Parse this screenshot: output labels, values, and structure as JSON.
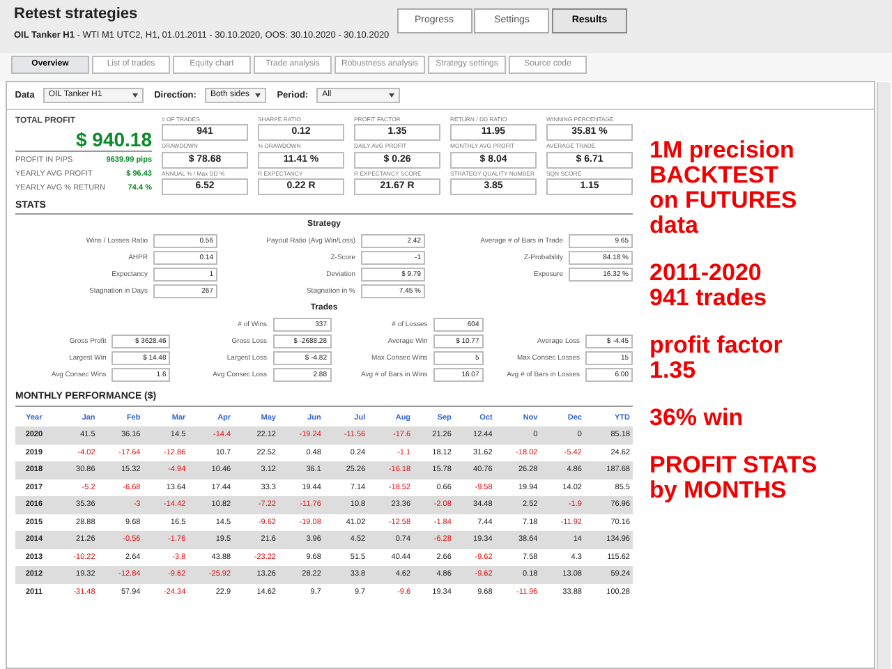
{
  "window": {
    "title": "Retest strategies",
    "subtitle_bold": "OIL Tanker H1",
    "subtitle": "- WTI  M1  UTC2, H1, 01.01.2011 - 30.10.2020, OOS: 30.10.2020 - 30.10.2020"
  },
  "top_buttons": [
    {
      "label": "Progress",
      "selected": false
    },
    {
      "label": "Settings",
      "selected": false
    },
    {
      "label": "Results",
      "selected": true
    }
  ],
  "tabs": [
    {
      "label": "Overview",
      "selected": true
    },
    {
      "label": "List of trades",
      "selected": false
    },
    {
      "label": "Equity chart",
      "selected": false
    },
    {
      "label": "Trade analysis",
      "selected": false
    },
    {
      "label": "Robustness analysis",
      "selected": false
    },
    {
      "label": "Strategy settings",
      "selected": false
    },
    {
      "label": "Source code",
      "selected": false
    }
  ],
  "filters": [
    {
      "label": "Data",
      "value": "OIL Tanker H1"
    },
    {
      "label": "Direction:",
      "value": "Both sides"
    },
    {
      "label": "Period:",
      "value": "All"
    }
  ],
  "total_profit": {
    "title": "TOTAL PROFIT",
    "value": "$ 940.18",
    "details": [
      {
        "label": "PROFIT IN PIPS",
        "value": "9639.99 pips"
      },
      {
        "label": "YEARLY AVG PROFIT",
        "value": "$ 96.43"
      },
      {
        "label": "YEARLY AVG % RETURN",
        "value": "74.4 %"
      }
    ]
  },
  "metrics": [
    {
      "label": "# OF TRADES",
      "value": "941"
    },
    {
      "label": "SHARPE RATIO",
      "value": "0.12"
    },
    {
      "label": "PROFIT FACTOR",
      "value": "1.35"
    },
    {
      "label": "RETURN / DD RATIO",
      "value": "11.95"
    },
    {
      "label": "WINNING PERCENTAGE",
      "value": "35.81 %"
    },
    {
      "label": "DRAWDOWN",
      "value": "$ 78.68"
    },
    {
      "label": "% DRAWDOWN",
      "value": "11.41 %"
    },
    {
      "label": "DAILY AVG PROFIT",
      "value": "$ 0.26"
    },
    {
      "label": "MONTHLY AVG PROFIT",
      "value": "$ 8.04"
    },
    {
      "label": "AVERAGE TRADE",
      "value": "$ 6.71"
    },
    {
      "label": "ANNUAL % / Max DD %",
      "value": "6.52"
    },
    {
      "label": "R EXPECTANCY",
      "value": "0.22 R"
    },
    {
      "label": "R EXPECTANCY SCORE",
      "value": "21.67 R"
    },
    {
      "label": "STRATEGY QUALITY NUMBER",
      "value": "3.85"
    },
    {
      "label": "SQN SCORE",
      "value": "1.15"
    }
  ],
  "stats": {
    "title": "STATS",
    "strategy_title": "Strategy",
    "strategy": [
      {
        "label": "Wins / Losses Ratio",
        "value": "0.56"
      },
      {
        "label": "Payout Ratio (Avg Win/Loss)",
        "value": "2.42"
      },
      {
        "label": "Average # of Bars in Trade",
        "value": "9.65"
      },
      {
        "label": "AHPR",
        "value": "0.14"
      },
      {
        "label": "Z-Score",
        "value": "-1"
      },
      {
        "label": "Z-Probability",
        "value": "84.18 %"
      },
      {
        "label": "Expectancy",
        "value": "1"
      },
      {
        "label": "Deviation",
        "value": "$ 9.79"
      },
      {
        "label": "Exposure",
        "value": "16.32 %"
      },
      {
        "label": "Stagnation in Days",
        "value": "267"
      },
      {
        "label": "Stagnation in %",
        "value": "7.45 %"
      }
    ],
    "trades_title": "Trades",
    "trades_top": [
      {
        "label": "# of Wins",
        "value": "337"
      },
      {
        "label": "# of Losses",
        "value": "604"
      }
    ],
    "trades": [
      {
        "label": "Gross Profit",
        "value": "$ 3628.46"
      },
      {
        "label": "Gross Loss",
        "value": "$ -2688.28"
      },
      {
        "label": "Average Win",
        "value": "$ 10.77"
      },
      {
        "label": "Average Loss",
        "value": "$ -4.45"
      },
      {
        "label": "Largest Win",
        "value": "$ 14.48"
      },
      {
        "label": "Largest Loss",
        "value": "$ -4.82"
      },
      {
        "label": "Max Consec Wins",
        "value": "5"
      },
      {
        "label": "Max Consec Losses",
        "value": "15"
      },
      {
        "label": "Avg Consec Wins",
        "value": "1.6"
      },
      {
        "label": "Avg Consec Loss",
        "value": "2.88"
      },
      {
        "label": "Avg # of Bars in Wins",
        "value": "16.07"
      },
      {
        "label": "Avg # of Bars in Losses",
        "value": "6.00"
      }
    ]
  },
  "monthly": {
    "title": "MONTHLY PERFORMANCE ($)",
    "year_header": "Year",
    "columns": [
      "Jan",
      "Feb",
      "Mar",
      "Apr",
      "May",
      "Jun",
      "Jul",
      "Aug",
      "Sep",
      "Oct",
      "Nov",
      "Dec",
      "YTD"
    ],
    "rows": [
      {
        "year": "2020",
        "cells": [
          {
            "value": "41.5",
            "negative": false
          },
          {
            "value": "36.16",
            "negative": false
          },
          {
            "value": "14.5",
            "negative": false
          },
          {
            "value": "-14.4",
            "negative": true
          },
          {
            "value": "22.12",
            "negative": false
          },
          {
            "value": "-19.24",
            "negative": true
          },
          {
            "value": "-11.56",
            "negative": true
          },
          {
            "value": "-17.6",
            "negative": true
          },
          {
            "value": "21.26",
            "negative": false
          },
          {
            "value": "12.44",
            "negative": false
          },
          {
            "value": "0",
            "negative": false
          },
          {
            "value": "0",
            "negative": false
          },
          {
            "value": "85.18",
            "negative": false
          }
        ]
      },
      {
        "year": "2019",
        "cells": [
          {
            "value": "-4.02",
            "negative": true
          },
          {
            "value": "-17.64",
            "negative": true
          },
          {
            "value": "-12.86",
            "negative": true
          },
          {
            "value": "10.7",
            "negative": false
          },
          {
            "value": "22.52",
            "negative": false
          },
          {
            "value": "0.48",
            "negative": false
          },
          {
            "value": "0.24",
            "negative": false
          },
          {
            "value": "-1.1",
            "negative": true
          },
          {
            "value": "18.12",
            "negative": false
          },
          {
            "value": "31.62",
            "negative": false
          },
          {
            "value": "-18.02",
            "negative": true
          },
          {
            "value": "-5.42",
            "negative": true
          },
          {
            "value": "24.62",
            "negative": false
          }
        ]
      },
      {
        "year": "2018",
        "cells": [
          {
            "value": "30.86",
            "negative": false
          },
          {
            "value": "15.32",
            "negative": false
          },
          {
            "value": "-4.94",
            "negative": true
          },
          {
            "value": "10.46",
            "negative": false
          },
          {
            "value": "3.12",
            "negative": false
          },
          {
            "value": "36.1",
            "negative": false
          },
          {
            "value": "25.26",
            "negative": false
          },
          {
            "value": "-16.18",
            "negative": true
          },
          {
            "value": "15.78",
            "negative": false
          },
          {
            "value": "40.76",
            "negative": false
          },
          {
            "value": "26.28",
            "negative": false
          },
          {
            "value": "4.86",
            "negative": false
          },
          {
            "value": "187.68",
            "negative": false
          }
        ]
      },
      {
        "year": "2017",
        "cells": [
          {
            "value": "-5.2",
            "negative": true
          },
          {
            "value": "-6.68",
            "negative": true
          },
          {
            "value": "13.64",
            "negative": false
          },
          {
            "value": "17.44",
            "negative": false
          },
          {
            "value": "33.3",
            "negative": false
          },
          {
            "value": "19.44",
            "negative": false
          },
          {
            "value": "7.14",
            "negative": false
          },
          {
            "value": "-18.52",
            "negative": true
          },
          {
            "value": "0.66",
            "negative": false
          },
          {
            "value": "-9.58",
            "negative": true
          },
          {
            "value": "19.94",
            "negative": false
          },
          {
            "value": "14.02",
            "negative": false
          },
          {
            "value": "85.5",
            "negative": false
          }
        ]
      },
      {
        "year": "2016",
        "cells": [
          {
            "value": "35.36",
            "negative": false
          },
          {
            "value": "-3",
            "negative": true
          },
          {
            "value": "-14.42",
            "negative": true
          },
          {
            "value": "10.82",
            "negative": false
          },
          {
            "value": "-7.22",
            "negative": true
          },
          {
            "value": "-11.76",
            "negative": true
          },
          {
            "value": "10.8",
            "negative": false
          },
          {
            "value": "23.36",
            "negative": false
          },
          {
            "value": "-2.08",
            "negative": true
          },
          {
            "value": "34.48",
            "negative": false
          },
          {
            "value": "2.52",
            "negative": false
          },
          {
            "value": "-1.9",
            "negative": true
          },
          {
            "value": "76.96",
            "negative": false
          }
        ]
      },
      {
        "year": "2015",
        "cells": [
          {
            "value": "28.88",
            "negative": false
          },
          {
            "value": "9.68",
            "negative": false
          },
          {
            "value": "16.5",
            "negative": false
          },
          {
            "value": "14.5",
            "negative": false
          },
          {
            "value": "-9.62",
            "negative": true
          },
          {
            "value": "-19.08",
            "negative": true
          },
          {
            "value": "41.02",
            "negative": false
          },
          {
            "value": "-12.58",
            "negative": true
          },
          {
            "value": "-1.84",
            "negative": true
          },
          {
            "value": "7.44",
            "negative": false
          },
          {
            "value": "7.18",
            "negative": false
          },
          {
            "value": "-11.92",
            "negative": true
          },
          {
            "value": "70.16",
            "negative": false
          }
        ]
      },
      {
        "year": "2014",
        "cells": [
          {
            "value": "21.26",
            "negative": false
          },
          {
            "value": "-0.56",
            "negative": true
          },
          {
            "value": "-1.76",
            "negative": true
          },
          {
            "value": "19.5",
            "negative": false
          },
          {
            "value": "21.6",
            "negative": false
          },
          {
            "value": "3.96",
            "negative": false
          },
          {
            "value": "4.52",
            "negative": false
          },
          {
            "value": "0.74",
            "negative": false
          },
          {
            "value": "-6.28",
            "negative": true
          },
          {
            "value": "19.34",
            "negative": false
          },
          {
            "value": "38.64",
            "negative": false
          },
          {
            "value": "14",
            "negative": false
          },
          {
            "value": "134.96",
            "negative": false
          }
        ]
      },
      {
        "year": "2013",
        "cells": [
          {
            "value": "-10.22",
            "negative": true
          },
          {
            "value": "2.64",
            "negative": false
          },
          {
            "value": "-3.8",
            "negative": true
          },
          {
            "value": "43.88",
            "negative": false
          },
          {
            "value": "-23.22",
            "negative": true
          },
          {
            "value": "9.68",
            "negative": false
          },
          {
            "value": "51.5",
            "negative": false
          },
          {
            "value": "40.44",
            "negative": false
          },
          {
            "value": "2.66",
            "negative": false
          },
          {
            "value": "-9.62",
            "negative": true
          },
          {
            "value": "7.58",
            "negative": false
          },
          {
            "value": "4.3",
            "negative": false
          },
          {
            "value": "115.62",
            "negative": false
          }
        ]
      },
      {
        "year": "2012",
        "cells": [
          {
            "value": "19.32",
            "negative": false
          },
          {
            "value": "-12.84",
            "negative": true
          },
          {
            "value": "-9.62",
            "negative": true
          },
          {
            "value": "-25.92",
            "negative": true
          },
          {
            "value": "13.26",
            "negative": false
          },
          {
            "value": "28.22",
            "negative": false
          },
          {
            "value": "33.8",
            "negative": false
          },
          {
            "value": "4.62",
            "negative": false
          },
          {
            "value": "4.86",
            "negative": false
          },
          {
            "value": "-9.62",
            "negative": true
          },
          {
            "value": "0.18",
            "negative": false
          },
          {
            "value": "13.08",
            "negative": false
          },
          {
            "value": "59.24",
            "negative": false
          }
        ]
      },
      {
        "year": "2011",
        "cells": [
          {
            "value": "-31.48",
            "negative": true
          },
          {
            "value": "57.94",
            "negative": false
          },
          {
            "value": "-24.34",
            "negative": true
          },
          {
            "value": "22.9",
            "negative": false
          },
          {
            "value": "14.62",
            "negative": false
          },
          {
            "value": "9.7",
            "negative": false
          },
          {
            "value": "9.7",
            "negative": false
          },
          {
            "value": "-9.6",
            "negative": true
          },
          {
            "value": "19.34",
            "negative": false
          },
          {
            "value": "9.68",
            "negative": false
          },
          {
            "value": "-11.96",
            "negative": true
          },
          {
            "value": "33.88",
            "negative": false
          },
          {
            "value": "100.28",
            "negative": false
          }
        ]
      }
    ]
  },
  "promo_notes": [
    {
      "lines": [
        "1M precision",
        "BACKTEST",
        "on FUTURES",
        "data"
      ]
    },
    {
      "lines": [
        "2011-2020",
        "941 trades"
      ]
    },
    {
      "lines": [
        "profit factor",
        "1.35"
      ]
    },
    {
      "lines": [
        "36% win"
      ]
    },
    {
      "lines": [
        "PROFIT STATS",
        "by MONTHS"
      ]
    }
  ]
}
